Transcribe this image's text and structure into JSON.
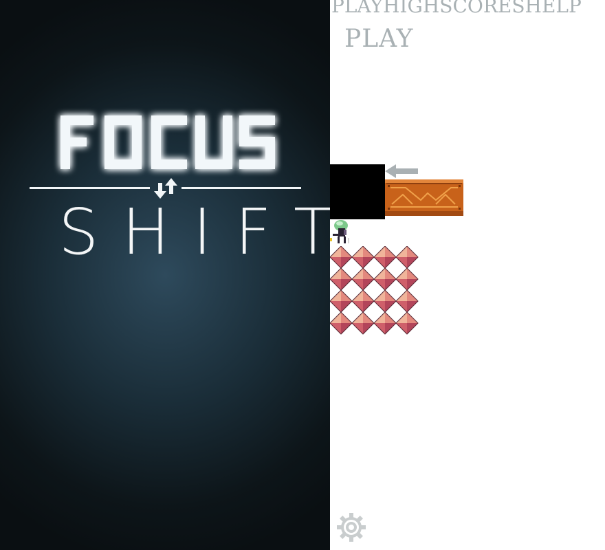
{
  "splash": {
    "title_top": "FOCUS",
    "title_bottom": "SHIFT"
  },
  "menu": {
    "items": [
      "PLAY",
      "HIGHSCORES",
      "HELP"
    ]
  },
  "heading": "PLAY",
  "icons": {
    "swap": "swap-arrows-icon",
    "arrow": "left-arrow-icon",
    "settings": "gear-icon"
  },
  "colors": {
    "menu_text": "#a9b1b4",
    "crate": "#c8621a",
    "spikes": "#d9766e"
  }
}
